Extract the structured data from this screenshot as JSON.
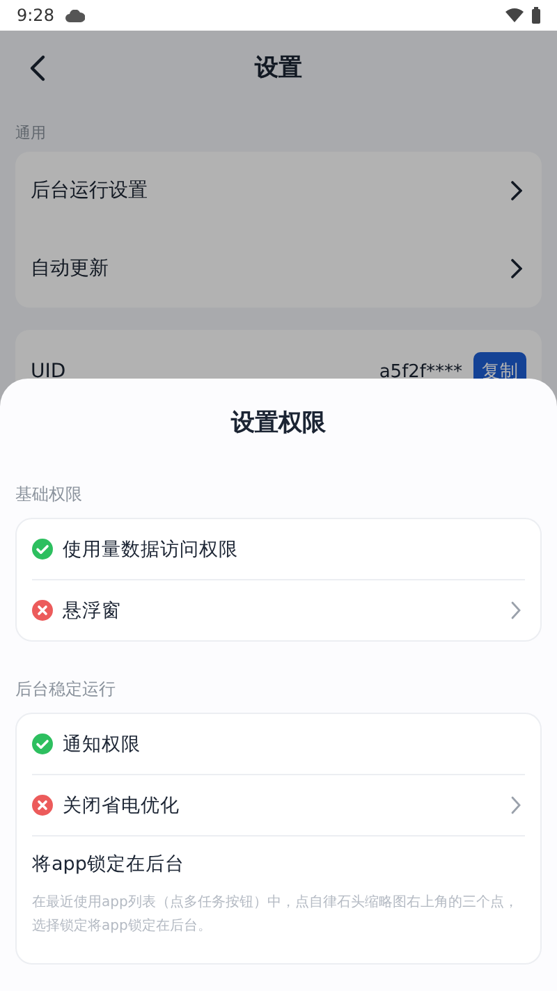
{
  "status_bar": {
    "time": "9:28"
  },
  "page": {
    "title": "设置",
    "section": "通用",
    "items": [
      {
        "label": "后台运行设置"
      },
      {
        "label": "自动更新"
      }
    ],
    "uid": {
      "label": "UID",
      "value": "a5f2f****",
      "button": "复制"
    }
  },
  "sheet": {
    "title": "设置权限",
    "groups": [
      {
        "title": "基础权限",
        "items": [
          {
            "kind": "status",
            "label": "使用量数据访问权限",
            "granted": true,
            "arrow": false
          },
          {
            "kind": "status",
            "label": "悬浮窗",
            "granted": false,
            "arrow": true
          }
        ]
      },
      {
        "title": "后台稳定运行",
        "items": [
          {
            "kind": "status",
            "label": "通知权限",
            "granted": true,
            "arrow": false
          },
          {
            "kind": "status",
            "label": "关闭省电优化",
            "granted": false,
            "arrow": true
          },
          {
            "kind": "note",
            "label": "将app锁定在后台",
            "description": "在最近使用app列表（点多任务按钮）中，点自律石头缩略图右上角的三个点，选择锁定将app锁定在后台。"
          }
        ]
      }
    ]
  }
}
